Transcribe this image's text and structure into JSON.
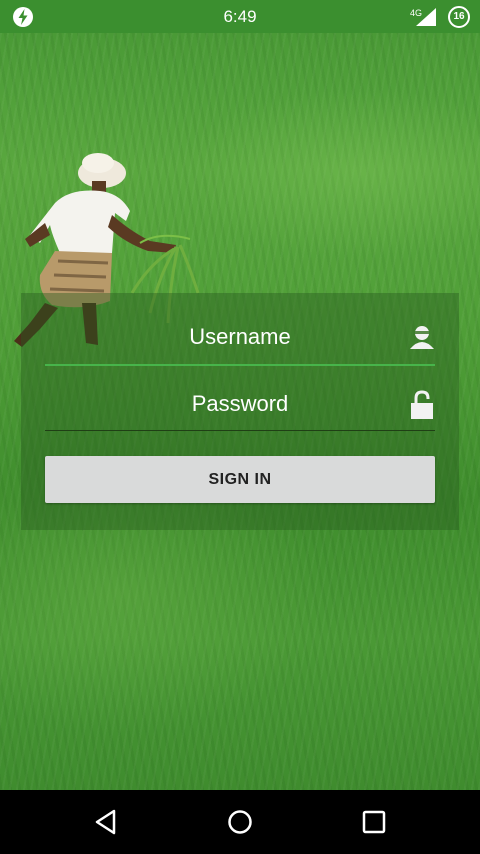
{
  "status_bar": {
    "time": "6:49",
    "network": "4G",
    "battery_level": "16",
    "icons": [
      "flash-icon",
      "signal-icon",
      "battery-icon"
    ]
  },
  "login": {
    "username_placeholder": "Username",
    "password_placeholder": "Password",
    "sign_in_label": "SIGN IN",
    "icons": [
      "user-icon",
      "lock-icon"
    ]
  },
  "nav_bar": {
    "icons": [
      "back-icon",
      "home-icon",
      "recents-icon"
    ]
  },
  "colors": {
    "status_bar": "#3b8f2f",
    "accent_line": "#47b44a",
    "button_bg": "#d9dada"
  }
}
